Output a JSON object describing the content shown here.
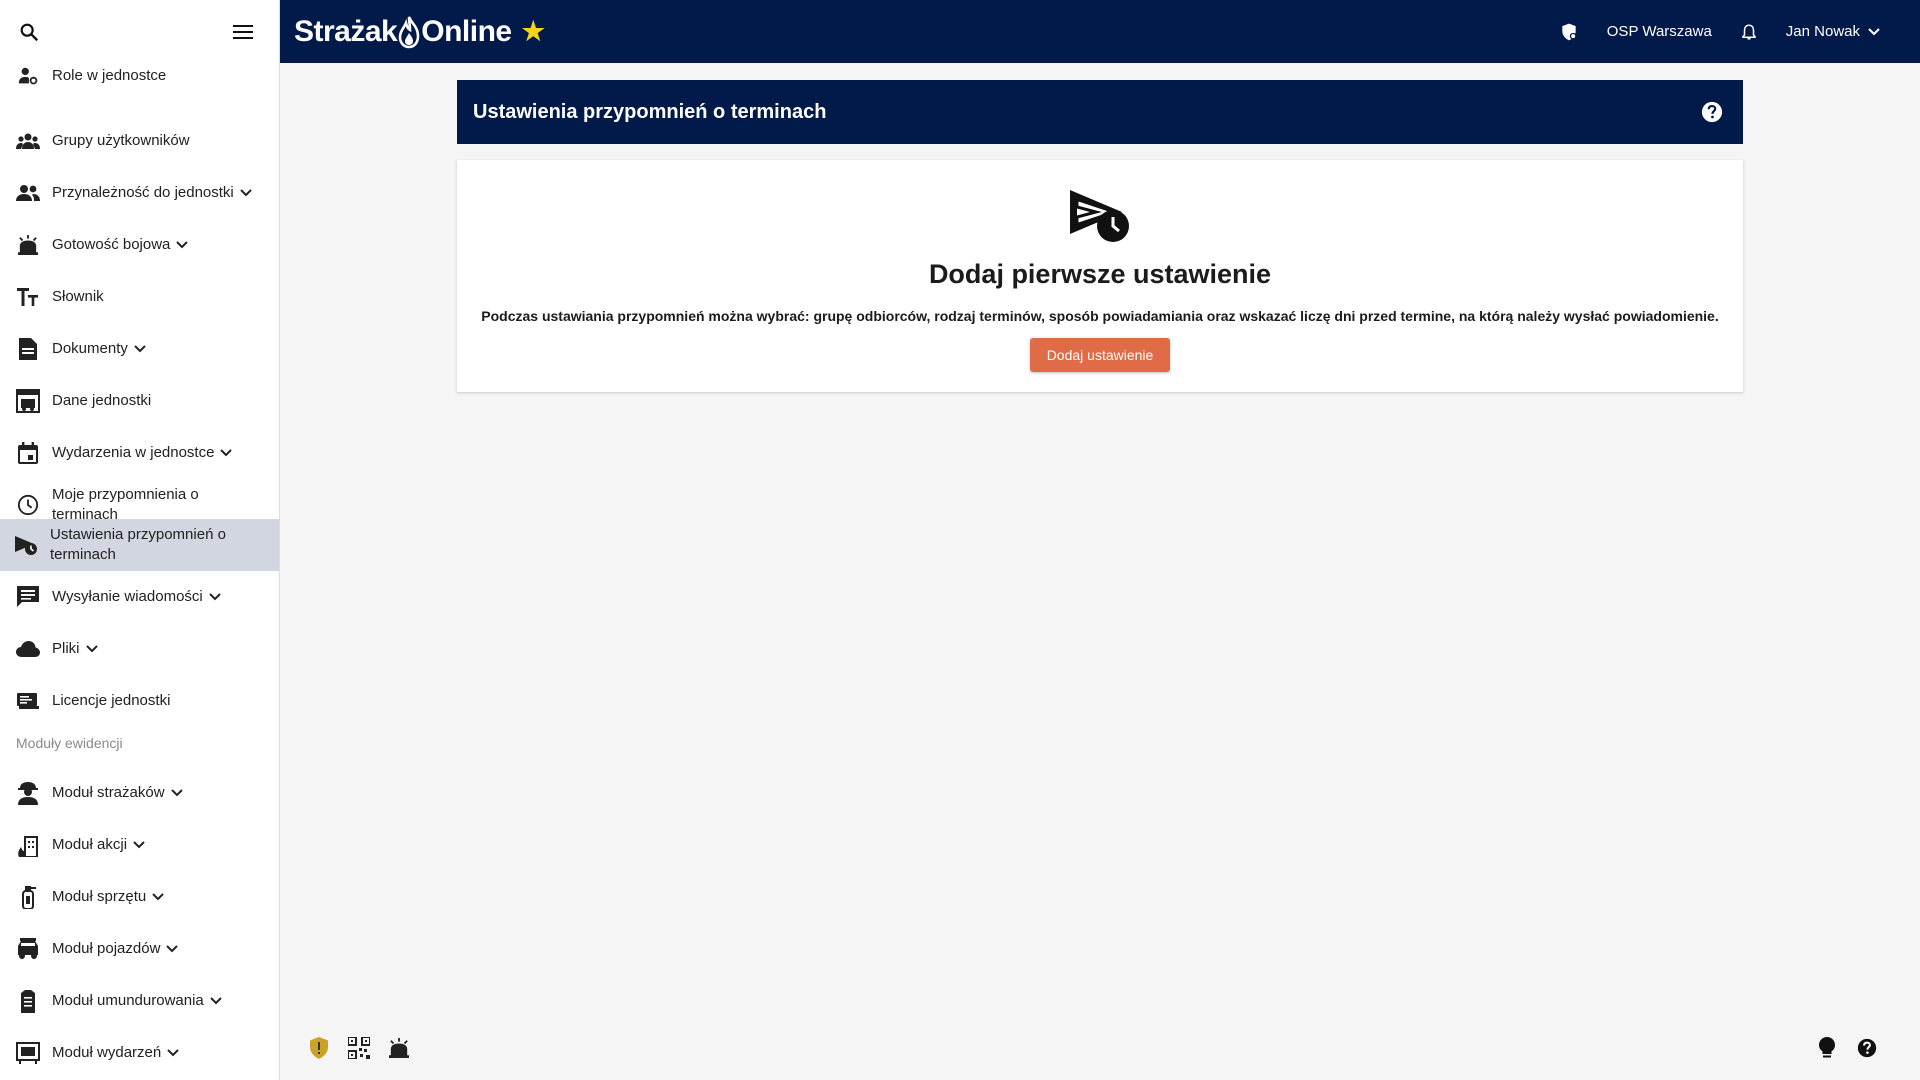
{
  "app": {
    "brand_left": "Strażak",
    "brand_right": "Online"
  },
  "topbar": {
    "unit": "OSP Warszawa",
    "user": "Jan Nowak"
  },
  "sidebar": {
    "items": [
      {
        "label": "Role w jednostce",
        "icon": "role-user-gear-icon",
        "chevron": false
      },
      {
        "label": "Grupy użytkowników",
        "icon": "groups-icon",
        "chevron": false
      },
      {
        "label": "Przynależność do jednostki",
        "icon": "people-icon",
        "chevron": true
      },
      {
        "label": "Gotowość bojowa",
        "icon": "readiness-siren-icon",
        "chevron": true
      },
      {
        "label": "Słownik",
        "icon": "text-fields-icon",
        "chevron": false
      },
      {
        "label": "Dokumenty",
        "icon": "document-icon",
        "chevron": true
      },
      {
        "label": "Dane jednostki",
        "icon": "fire-station-icon",
        "chevron": false
      },
      {
        "label": "Wydarzenia w jednostce",
        "icon": "calendar-icon",
        "chevron": true
      },
      {
        "label": "Moje przypomnienia o terminach",
        "icon": "clock-icon",
        "chevron": false
      },
      {
        "label": "Ustawienia przypomnień o terminach",
        "icon": "send-clock-icon",
        "chevron": false
      },
      {
        "label": "Wysyłanie wiadomości",
        "icon": "message-icon",
        "chevron": true
      },
      {
        "label": "Pliki",
        "icon": "cloud-icon",
        "chevron": true
      },
      {
        "label": "Licencje jednostki",
        "icon": "license-icon",
        "chevron": false
      }
    ],
    "section_label": "Moduły ewidencji",
    "modules": [
      {
        "label": "Moduł strażaków",
        "icon": "firefighter-icon",
        "chevron": true
      },
      {
        "label": "Moduł akcji",
        "icon": "fire-building-icon",
        "chevron": true
      },
      {
        "label": "Moduł sprzętu",
        "icon": "extinguisher-icon",
        "chevron": true
      },
      {
        "label": "Moduł pojazdów",
        "icon": "vehicle-icon",
        "chevron": true
      },
      {
        "label": "Moduł umundurowania",
        "icon": "uniform-icon",
        "chevron": true
      },
      {
        "label": "Moduł wydarzeń",
        "icon": "event-board-icon",
        "chevron": true
      }
    ]
  },
  "main": {
    "header_title": "Ustawienia przypomnień o terminach",
    "empty_title": "Dodaj pierwsze ustawienie",
    "empty_description": "Podczas ustawiania przypomnień można wybrać: grupę odbiorców, rodzaj terminów, sposób powiadamiania oraz wskazać liczę dni przed termine, na którą należy wysłać powiadomienie.",
    "add_button": "Dodaj ustawienie"
  },
  "colors": {
    "navy": "#021a4a",
    "accent": "#e06b47",
    "active_bg": "#d2d6e0",
    "star": "#f7d21a",
    "shield": "#c9a227"
  }
}
